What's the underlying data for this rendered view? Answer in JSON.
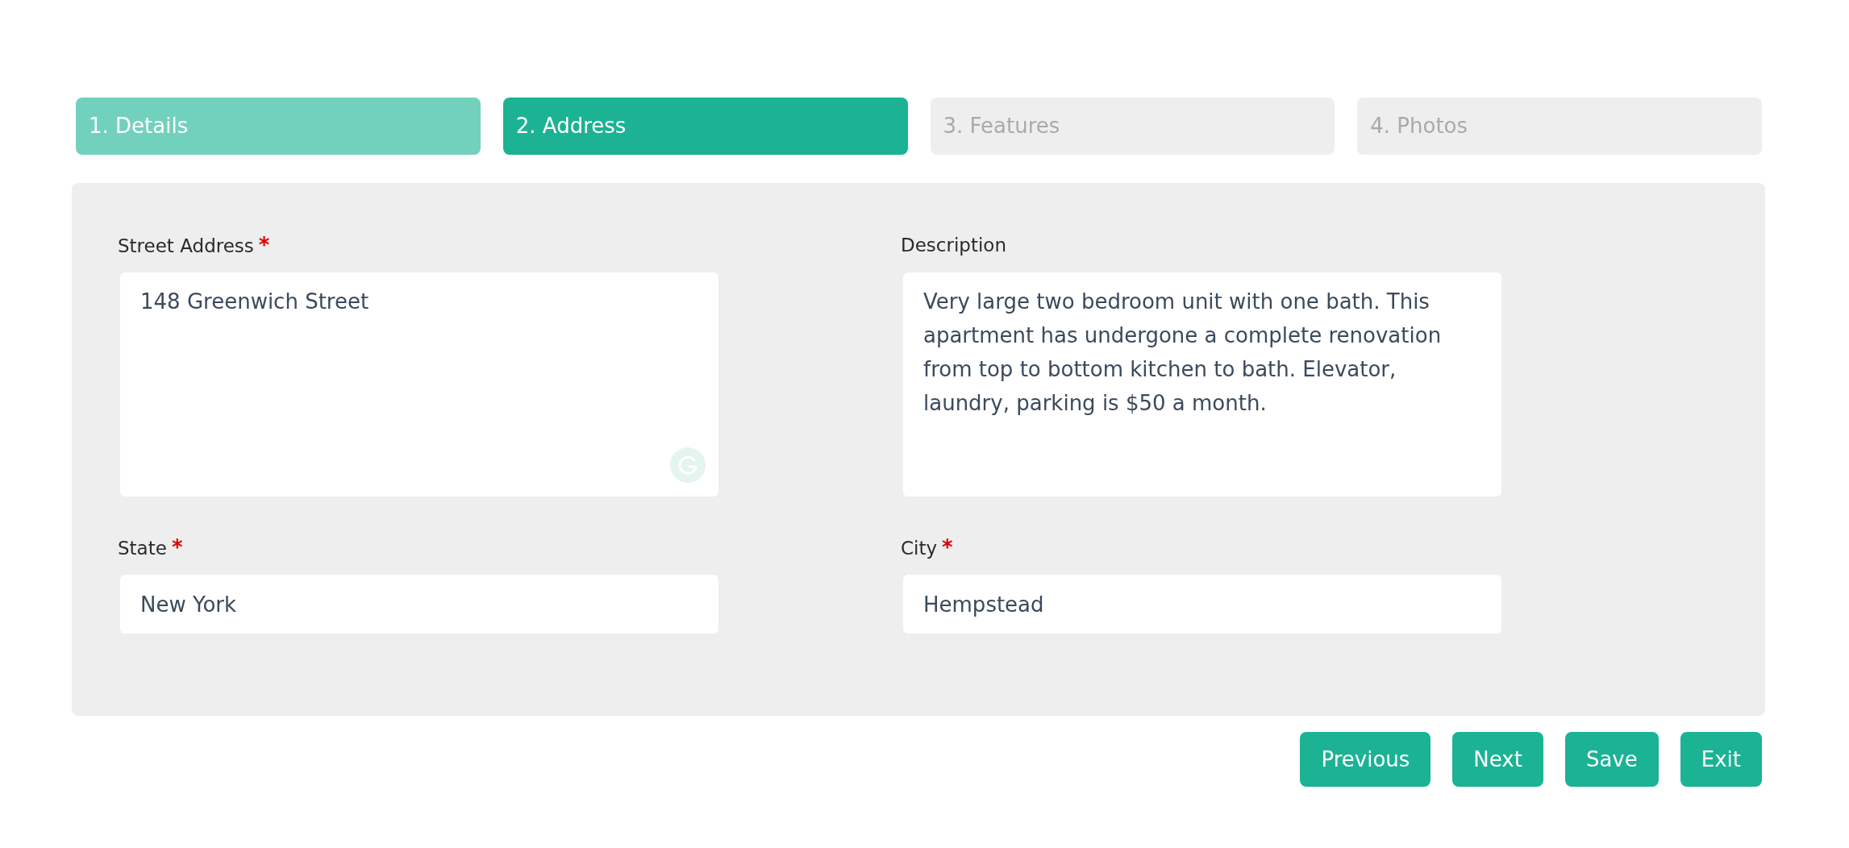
{
  "steps": [
    {
      "label": "1. Details",
      "selected": false,
      "completed": true
    },
    {
      "label": "2. Address",
      "selected": true,
      "completed": false
    },
    {
      "label": "3. Features",
      "selected": false,
      "completed": false
    },
    {
      "label": "4. Photos",
      "selected": false,
      "completed": false
    }
  ],
  "form": {
    "fields": [
      {
        "label": "Street Address",
        "required_mark": "*",
        "kind": "textarea",
        "value": "148 Greenwich Street",
        "assistant_badge": true
      },
      {
        "label": "Description",
        "kind": "textarea",
        "value": "Very large two bedroom unit with one bath. This apartment has undergone a complete renovation from top to bottom kitchen to bath. Elevator, laundry, parking is $50 a month."
      },
      {
        "label": "State",
        "required_mark": "*",
        "kind": "input",
        "value": "New York"
      },
      {
        "label": "City",
        "required_mark": "*",
        "kind": "input",
        "value": "Hempstead"
      }
    ]
  },
  "buttons": [
    {
      "label": "Previous"
    },
    {
      "label": "Next"
    },
    {
      "label": "Save"
    },
    {
      "label": "Exit"
    }
  ]
}
